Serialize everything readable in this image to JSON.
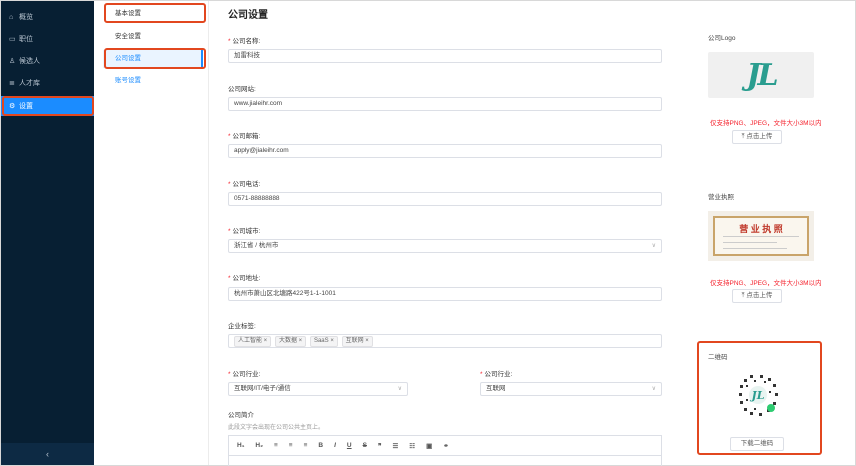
{
  "sidebar": {
    "items": [
      {
        "icon": "home-icon",
        "glyph": "⌂",
        "label": "概览"
      },
      {
        "icon": "monitor-icon",
        "glyph": "▭",
        "label": "职位"
      },
      {
        "icon": "person-icon",
        "glyph": "♙",
        "label": "候选人"
      },
      {
        "icon": "list-icon",
        "glyph": "≣",
        "label": "人才库"
      },
      {
        "icon": "gear-icon",
        "glyph": "⚙",
        "label": "设置"
      }
    ],
    "collapse_glyph": "‹"
  },
  "subnav": {
    "items": [
      {
        "label": "基本设置"
      },
      {
        "label": "安全设置"
      },
      {
        "label": "公司设置"
      },
      {
        "label": "账号设置"
      }
    ]
  },
  "form": {
    "title": "公司设置",
    "company_name_label": "公司名称:",
    "company_name_value": "加雷科技",
    "website_label": "公司网站:",
    "website_value": "www.jialeihr.com",
    "email_label": "公司邮箱:",
    "email_value": "apply@jialeihr.com",
    "phone_label": "公司电话:",
    "phone_value": "0571-88888888",
    "city_label": "公司城市:",
    "city_value": "浙江省 / 杭州市",
    "address_label": "公司地址:",
    "address_value": "杭州市萧山区北塘路422号1-1-1001",
    "tags_label": "企业标签:",
    "tags": [
      "人工智能 ×",
      "大数据 ×",
      "SaaS ×",
      "互联网 ×"
    ],
    "industry1_label": "公司行业:",
    "industry1_value": "互联网/IT/电子/通信",
    "industry2_label": "公司行业:",
    "industry2_value": "互联网",
    "intro_label": "公司简介",
    "intro_hint": "此段文字会出现在公司公共主页上。",
    "editor_tools": [
      "H₁",
      "H₂",
      "≡",
      "≡",
      "≡",
      "B",
      "I",
      "U",
      "S",
      "❞",
      "☰",
      "☷",
      "▣",
      "⚭"
    ]
  },
  "right": {
    "logo_label": "公司Logo",
    "logo_text": "JL",
    "logo_note": "仅支持PNG、JPEG，文件大小3M以内",
    "logo_upload": "⤒ 点击上传",
    "license_label": "营业执照",
    "license_text": "营 业 执 照",
    "license_note": "仅支持PNG、JPEG，文件大小3M以内",
    "license_upload": "⤒ 点击上传",
    "qr_label": "二维码",
    "qr_download": "下载二维码"
  },
  "colors": {
    "sidebar_bg": "#071f33",
    "accent": "#1b8cff",
    "highlight": "#e2471f",
    "required": "#f5222d"
  }
}
